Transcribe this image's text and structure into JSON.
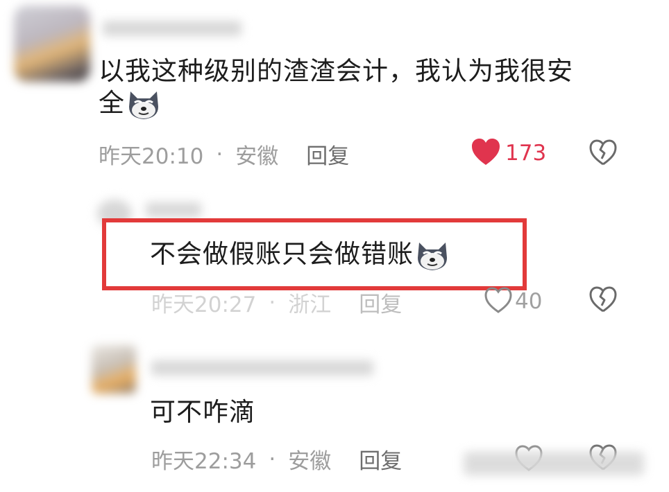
{
  "comments": [
    {
      "text": "以我这种级别的渣渣会计，我认为我很安全",
      "line1": "以我这种级别的渣渣会计，我认为我很安",
      "line2": "全",
      "time": "昨天20:10",
      "location": "安徽",
      "reply_label": "回复",
      "likes": "173",
      "liked": true
    },
    {
      "text": "不会做假账只会做错账",
      "time": "昨天20:27",
      "location": "浙江",
      "reply_label": "回复",
      "likes": "40",
      "liked": false,
      "highlighted": true
    },
    {
      "text": "可不咋滴",
      "time": "昨天22:34",
      "location": "安徽",
      "reply_label": "回复"
    }
  ],
  "separator": "·",
  "icons": {
    "like_filled": "heart-filled-icon",
    "like_outline": "heart-outline-icon",
    "dislike": "broken-heart-icon",
    "emoji": "husky-dog-emoji"
  },
  "colors": {
    "like_red": "#e0344e",
    "highlight_red": "#e23a3a",
    "meta_gray": "#9d9d9d"
  }
}
